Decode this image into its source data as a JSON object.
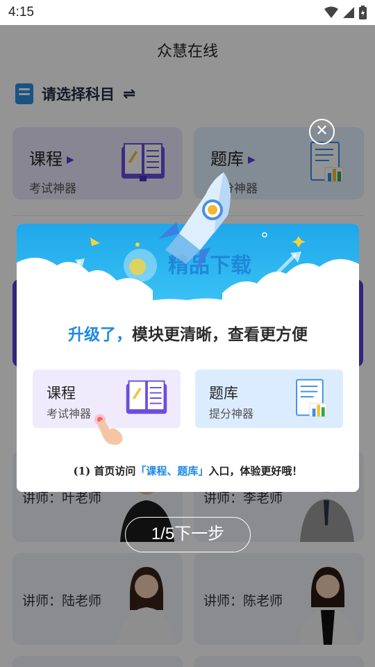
{
  "status_bar": {
    "time": "4:15"
  },
  "app": {
    "title": "众慧在线"
  },
  "subject": {
    "label": "请选择科目"
  },
  "cards": [
    {
      "title": "课程",
      "subtitle": "考试神器"
    },
    {
      "title": "题库",
      "subtitle": "提分神器"
    }
  ],
  "teachers": [
    {
      "name": "讲师：叶老师"
    },
    {
      "name": "讲师：李老师"
    },
    {
      "name": "讲师：陆老师"
    },
    {
      "name": "讲师：陈老师"
    }
  ],
  "modal": {
    "watermark_text": "精品下载",
    "headline_blue": "升级了，",
    "headline_rest": "模块更清晰，查看更方便",
    "cards": [
      {
        "title": "课程",
        "subtitle": "考试神器"
      },
      {
        "title": "题库",
        "subtitle": "提分神器"
      }
    ],
    "tip_prefix": "(1) 首页访问",
    "tip_highlight": "「课程、题库」",
    "tip_suffix": "入口，体验更好哦！",
    "close_icon": "close-icon"
  },
  "guide": {
    "next_label": "1/5下一步"
  },
  "colors": {
    "accent_blue": "#1e88e5",
    "purple": "#5a3fd6",
    "course_card_bg": "#ebe7fb",
    "bank_card_bg": "#e2efff"
  }
}
